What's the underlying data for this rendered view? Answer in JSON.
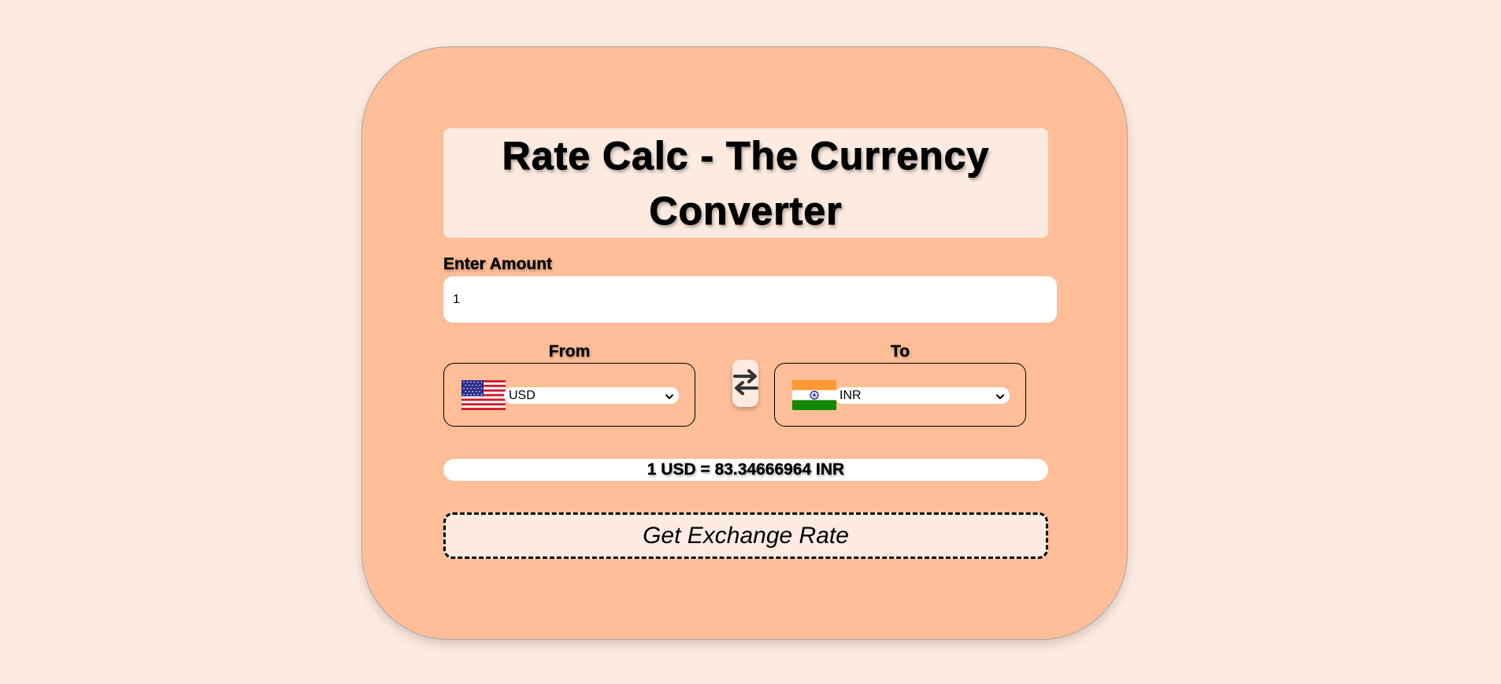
{
  "title": "Rate Calc - The Currency Converter",
  "amount": {
    "label": "Enter Amount",
    "value": "1"
  },
  "from": {
    "label": "From",
    "selected": "USD",
    "flag": "us-flag-icon"
  },
  "to": {
    "label": "To",
    "selected": "INR",
    "flag": "india-flag-icon"
  },
  "swap": {
    "icon": "swap-arrows-icon"
  },
  "result": {
    "text": "1 USD = 83.34666964 INR"
  },
  "button": {
    "label": "Get Exchange Rate"
  },
  "colors": {
    "page_bg": "#fdebe1",
    "card_bg": "#ffbe98",
    "text": "#000000"
  }
}
